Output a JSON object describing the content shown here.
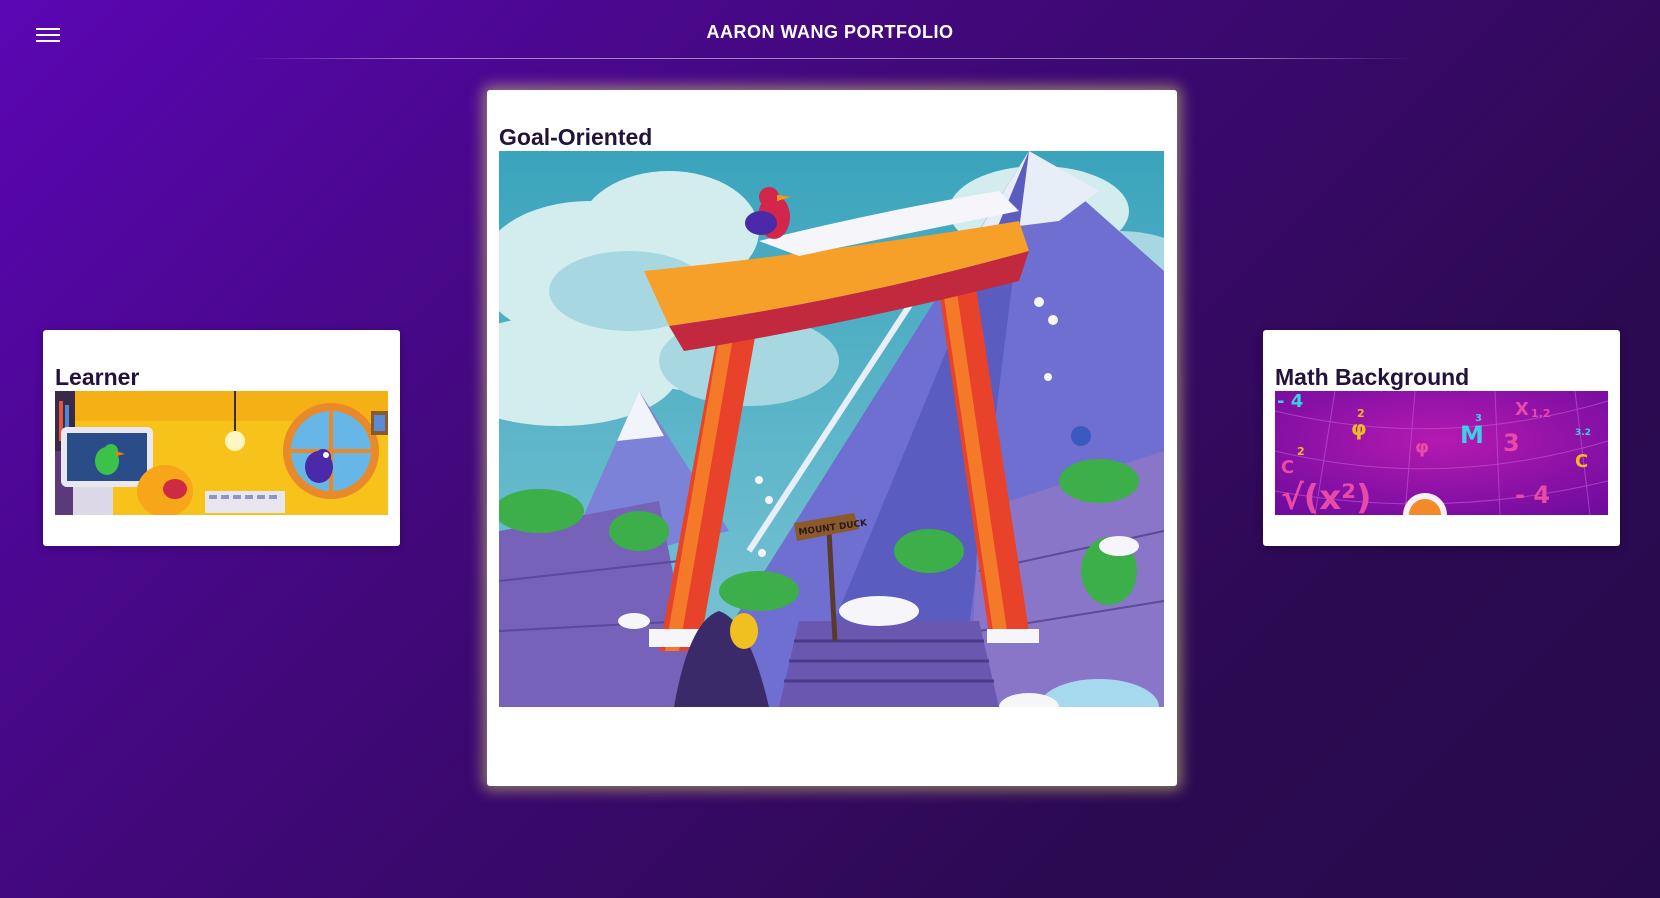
{
  "header": {
    "title": "AARON WANG PORTFOLIO",
    "menu_icon": "hamburger-menu-icon"
  },
  "carousel": {
    "cards": [
      {
        "title": "Learner",
        "image": "learner-illustration"
      },
      {
        "title": "Goal-Oriented",
        "image": "goal-oriented-illustration",
        "sign_text": "MOUNT DUCK"
      },
      {
        "title": "Math Background",
        "image": "math-background-illustration"
      }
    ]
  },
  "math_glyphs": [
    "- 4",
    "φ",
    "2",
    "φ",
    "M",
    "3",
    "3",
    "X",
    "1.2",
    "3.2",
    "C",
    "C",
    "2",
    "√(x²)",
    "- 4"
  ],
  "colors": {
    "background_start": "#5b06b4",
    "background_end": "#270a4c",
    "card_title": "#23123a",
    "active_glow": "#e6dc82"
  }
}
